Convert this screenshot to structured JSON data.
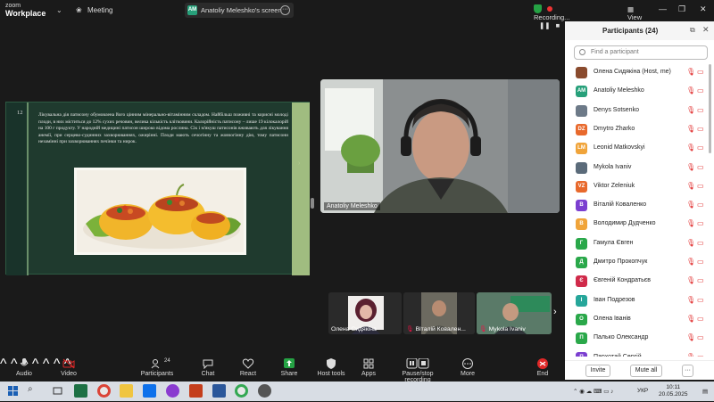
{
  "app": {
    "brand_top": "zoom",
    "brand_bottom": "Workplace",
    "meeting_label": "Meeting"
  },
  "share": {
    "avatar": "AM",
    "label": "Anatoliy Meleshko's screen"
  },
  "recording": {
    "label": "Recording...",
    "view": "View"
  },
  "slide": {
    "number": "12",
    "text": "Лікувальна дія патисону обумовлена його цінним мінерально-вітамінним складом. Найбільш поживні та корисні молоді плоди, в них міститься до 12% сухих речовин, велика кількість клітковини. Калорійність патисону – лише 19 кілокалорій на 100 г продукту. У народній медицині патисон широко відома рослина. Сік і м'якуш патисонів вживають для лікування анемії, при серцево-судинних захворюваннях, ожирінні. Плоди мають сечогінну та жовчогінну дію, тому патисони незамінні при захворюваннях печінки та нирок."
  },
  "speaker": {
    "name": "Anatoliy Meleshko"
  },
  "thumbnails": [
    {
      "name": "Олена Сидякіна"
    },
    {
      "name": "Віталій Ковален..."
    },
    {
      "name": "Mykola Ivaniv"
    }
  ],
  "participants": {
    "title": "Participants (24)",
    "search_placeholder": "Find a participant",
    "list": [
      {
        "initials": "",
        "name": "Олена Сидякіна (Host, me)",
        "color": "#8a4b2e"
      },
      {
        "initials": "AM",
        "name": "Anatoliy Meleshko",
        "color": "#27a07a"
      },
      {
        "initials": "",
        "name": "Denys Sotsenko",
        "color": "#6d7a88"
      },
      {
        "initials": "DZ",
        "name": "Dmytro Zharko",
        "color": "#e8692c"
      },
      {
        "initials": "LM",
        "name": "Leonid Matkovskyi",
        "color": "#f0a43a"
      },
      {
        "initials": "",
        "name": "Mykola Ivaniv",
        "color": "#5b6b7a"
      },
      {
        "initials": "VZ",
        "name": "Viktor Zeleniuk",
        "color": "#e8692c"
      },
      {
        "initials": "В",
        "name": "Віталій Коваленко",
        "color": "#7b3fd0"
      },
      {
        "initials": "В",
        "name": "Володимир Дудченко",
        "color": "#f0a43a"
      },
      {
        "initials": "Г",
        "name": "Гамула Євген",
        "color": "#2aa84a"
      },
      {
        "initials": "Д",
        "name": "Дмитро Прокопчук",
        "color": "#2aa84a"
      },
      {
        "initials": "Є",
        "name": "Євгеній Кондратьєв",
        "color": "#d02a4a"
      },
      {
        "initials": "І",
        "name": "Іван Подрезов",
        "color": "#26a69a"
      },
      {
        "initials": "О",
        "name": "Олена Іванів",
        "color": "#2aa84a"
      },
      {
        "initials": "П",
        "name": "Палько Олександр",
        "color": "#2aa84a"
      },
      {
        "initials": "П",
        "name": "Пархотай Сергій",
        "color": "#7b3fd0"
      }
    ],
    "invite": "Invite",
    "mute_all": "Mute all"
  },
  "toolbar": {
    "audio": "Audio",
    "video": "Video",
    "participants": "Participants",
    "participants_count": "24",
    "chat": "Chat",
    "react": "React",
    "share": "Share",
    "host_tools": "Host tools",
    "apps": "Apps",
    "pause_rec": "Pause/stop recording",
    "more": "More",
    "end": "End"
  },
  "taskbar": {
    "lang": "УКР",
    "time": "10:11",
    "date": "20.05.2025"
  },
  "colors": {
    "accent": "#0e71eb",
    "share_green": "#25a244",
    "end_red": "#e02828"
  }
}
